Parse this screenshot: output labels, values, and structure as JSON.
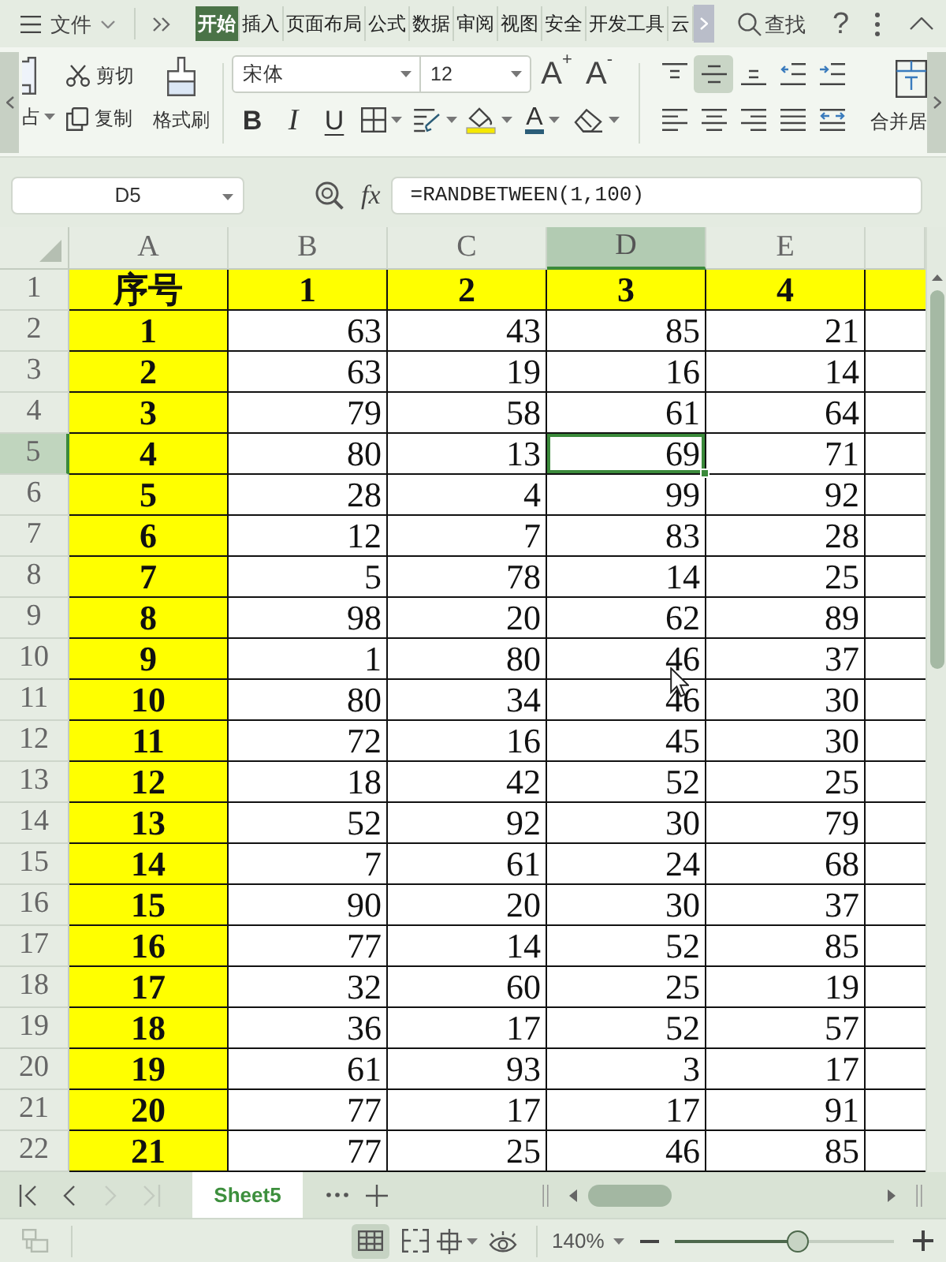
{
  "menu_bar": {
    "file_menu": "文件",
    "tabs": [
      {
        "label": "开始",
        "selected": true
      },
      {
        "label": "插入",
        "selected": false
      },
      {
        "label": "页面布局",
        "selected": false
      },
      {
        "label": "公式",
        "selected": false
      },
      {
        "label": "数据",
        "selected": false
      },
      {
        "label": "审阅",
        "selected": false
      },
      {
        "label": "视图",
        "selected": false
      },
      {
        "label": "安全",
        "selected": false
      },
      {
        "label": "开发工具",
        "selected": false
      },
      {
        "label": "云",
        "selected": false
      }
    ],
    "search": "查找",
    "help": "?"
  },
  "ribbon": {
    "paste": "占",
    "cut": "剪切",
    "copy": "复制",
    "format_painter": "格式刷",
    "font_name": "宋体",
    "font_size": "12",
    "grow_font": "A$^{+}$",
    "shrink_font": "A$^{-}$",
    "bold": "B",
    "italic": "I",
    "underline": "U",
    "font_color": "A",
    "vertical_align": [
      {
        "kind": "top",
        "selected": false
      },
      {
        "kind": "middle",
        "selected": true
      },
      {
        "kind": "bottom",
        "selected": false
      }
    ],
    "merge": "合并居"
  },
  "formula_bar": {
    "name_box": "D5",
    "function_label": "fx",
    "formula": "=RANDBETWEEN(1,100)"
  },
  "sheet": {
    "columns": [
      {
        "letter": "A",
        "selected": false,
        "highlighted": true
      },
      {
        "letter": "B",
        "selected": false,
        "highlighted": false
      },
      {
        "letter": "C",
        "selected": false,
        "highlighted": false
      },
      {
        "letter": "D",
        "selected": true,
        "highlighted": false
      },
      {
        "letter": "E",
        "selected": false,
        "highlighted": false
      }
    ],
    "rows": [
      {
        "number": "1",
        "selected": false,
        "highlighted": true,
        "cells": [
          "序号",
          "1",
          "2",
          "3",
          "4"
        ]
      },
      {
        "number": "2",
        "selected": false,
        "highlighted": false,
        "cells": [
          "1",
          "63",
          "43",
          "85",
          "21"
        ]
      },
      {
        "number": "3",
        "selected": false,
        "highlighted": false,
        "cells": [
          "2",
          "63",
          "19",
          "16",
          "14"
        ]
      },
      {
        "number": "4",
        "selected": false,
        "highlighted": false,
        "cells": [
          "3",
          "79",
          "58",
          "61",
          "64"
        ]
      },
      {
        "number": "5",
        "selected": true,
        "highlighted": false,
        "cells": [
          "4",
          "80",
          "13",
          "69",
          "71"
        ]
      },
      {
        "number": "6",
        "selected": false,
        "highlighted": false,
        "cells": [
          "5",
          "28",
          "4",
          "99",
          "92"
        ]
      },
      {
        "number": "7",
        "selected": false,
        "highlighted": false,
        "cells": [
          "6",
          "12",
          "7",
          "83",
          "28"
        ]
      },
      {
        "number": "8",
        "selected": false,
        "highlighted": false,
        "cells": [
          "7",
          "5",
          "78",
          "14",
          "25"
        ]
      },
      {
        "number": "9",
        "selected": false,
        "highlighted": false,
        "cells": [
          "8",
          "98",
          "20",
          "62",
          "89"
        ]
      },
      {
        "number": "10",
        "selected": false,
        "highlighted": false,
        "cells": [
          "9",
          "1",
          "80",
          "46",
          "37"
        ]
      },
      {
        "number": "11",
        "selected": false,
        "highlighted": false,
        "cells": [
          "10",
          "80",
          "34",
          "46",
          "30"
        ]
      },
      {
        "number": "12",
        "selected": false,
        "highlighted": false,
        "cells": [
          "11",
          "72",
          "16",
          "45",
          "30"
        ]
      },
      {
        "number": "13",
        "selected": false,
        "highlighted": false,
        "cells": [
          "12",
          "18",
          "42",
          "52",
          "25"
        ]
      },
      {
        "number": "14",
        "selected": false,
        "highlighted": false,
        "cells": [
          "13",
          "52",
          "92",
          "30",
          "79"
        ]
      },
      {
        "number": "15",
        "selected": false,
        "highlighted": false,
        "cells": [
          "14",
          "7",
          "61",
          "24",
          "68"
        ]
      },
      {
        "number": "16",
        "selected": false,
        "highlighted": false,
        "cells": [
          "15",
          "90",
          "20",
          "30",
          "37"
        ]
      },
      {
        "number": "17",
        "selected": false,
        "highlighted": false,
        "cells": [
          "16",
          "77",
          "14",
          "52",
          "85"
        ]
      },
      {
        "number": "18",
        "selected": false,
        "highlighted": false,
        "cells": [
          "17",
          "32",
          "60",
          "25",
          "19"
        ]
      },
      {
        "number": "19",
        "selected": false,
        "highlighted": false,
        "cells": [
          "18",
          "36",
          "17",
          "52",
          "57"
        ]
      },
      {
        "number": "20",
        "selected": false,
        "highlighted": false,
        "cells": [
          "19",
          "61",
          "93",
          "3",
          "17"
        ]
      },
      {
        "number": "21",
        "selected": false,
        "highlighted": false,
        "cells": [
          "20",
          "77",
          "17",
          "17",
          "91"
        ]
      },
      {
        "number": "22",
        "selected": false,
        "highlighted": false,
        "cells": [
          "21",
          "77",
          "25",
          "46",
          "85"
        ]
      }
    ]
  },
  "sheet_bar": {
    "navigation": [
      {
        "kind": "first",
        "disabled": false
      },
      {
        "kind": "prev",
        "disabled": false
      },
      {
        "kind": "next",
        "disabled": true
      },
      {
        "kind": "last",
        "disabled": true
      }
    ],
    "tabs": [
      {
        "label": "Sheet5",
        "selected": true
      }
    ]
  },
  "status_bar": {
    "views": [
      {
        "kind": "normal",
        "selected": true
      },
      {
        "kind": "page_break",
        "selected": false
      },
      {
        "kind": "page_layout",
        "selected": false
      }
    ],
    "zoom": "140%",
    "zoom_slider": {
      "level": 0.56
    }
  }
}
